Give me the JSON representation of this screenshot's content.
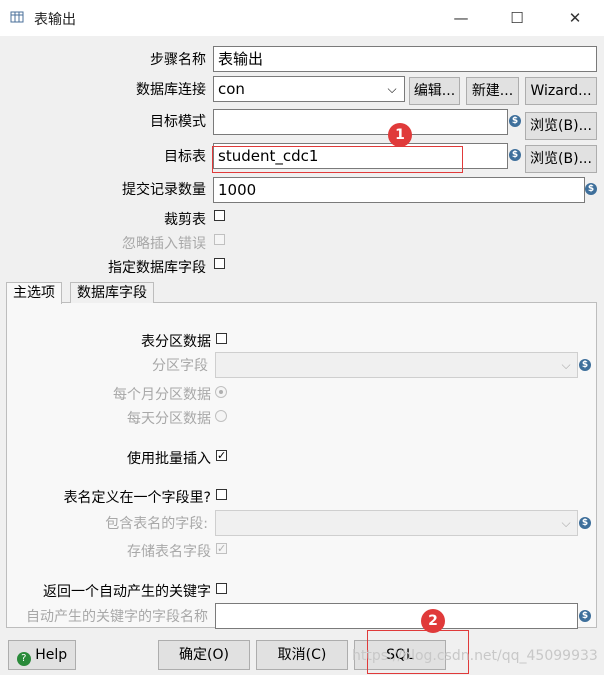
{
  "window": {
    "title": "表输出",
    "minimize": "—",
    "maximize": "☐",
    "close": "✕"
  },
  "form": {
    "step_name_label": "步骤名称",
    "step_name_value": "表输出",
    "db_connection_label": "数据库连接",
    "db_connection_value": "con",
    "edit_button": "编辑...",
    "new_button": "新建...",
    "wizard_button": "Wizard...",
    "target_schema_label": "目标模式",
    "target_schema_value": "",
    "browse_button": "浏览(B)...",
    "target_table_label": "目标表",
    "target_table_value": "student_cdc1",
    "commit_size_label": "提交记录数量",
    "commit_size_value": "1000",
    "truncate_label": "裁剪表",
    "ignore_errors_label": "忽略插入错误",
    "specify_fields_label": "指定数据库字段"
  },
  "tabs": [
    {
      "label": "主选项",
      "active": true
    },
    {
      "label": "数据库字段",
      "active": false
    }
  ],
  "main_tab": {
    "partition_label": "表分区数据",
    "partition_field_label": "分区字段",
    "monthly_label": "每个月分区数据",
    "daily_label": "每天分区数据",
    "batch_insert_label": "使用批量插入",
    "batch_insert_checked": true,
    "table_in_field_label": "表名定义在一个字段里?",
    "table_name_field_label": "包含表名的字段:",
    "store_table_name_label": "存储表名字段",
    "return_key_label": "返回一个自动产生的关键字",
    "auto_key_field_label": "自动产生的关键字的字段名称",
    "auto_key_field_value": ""
  },
  "footer": {
    "help_button": "Help",
    "ok_button": "确定(O)",
    "cancel_button": "取消(C)",
    "sql_button": "SQL"
  },
  "annotations": {
    "badge1": "1",
    "badge2": "2"
  },
  "watermark": "https://blog.csdn.net/qq_45099933",
  "colors": {
    "annotation": "#e03a3a",
    "variable_icon": "#3e6f9b",
    "help_icon": "#2a8a3a"
  }
}
